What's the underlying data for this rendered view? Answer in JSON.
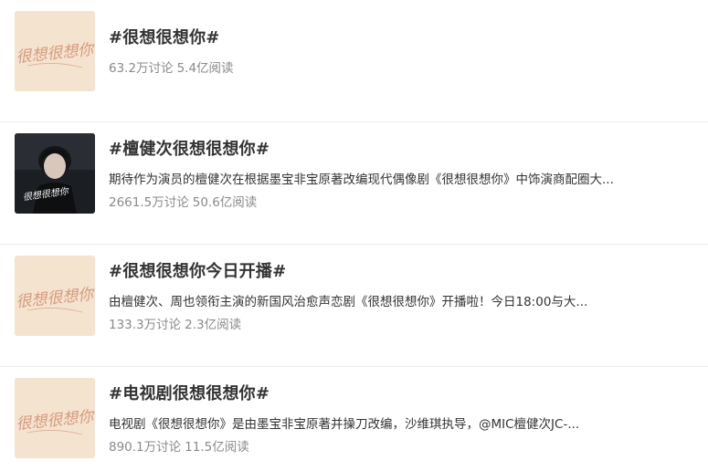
{
  "topics": [
    {
      "title": "#很想很想你#",
      "description": "",
      "discussions": "63.2万讨论",
      "reads": "5.4亿阅读",
      "thumbnail": {
        "kind": "poster",
        "background": "#f4e3cf",
        "script_color": "#d79a7e",
        "script_text": "很想很想你"
      }
    },
    {
      "title": "#檀健次很想很想你#",
      "description": "期待作为演员的檀健次在根据墨宝非宝原著改编现代偶像剧《很想很想你》中饰演商配圈大...",
      "discussions": "2661.5万讨论",
      "reads": "50.6亿阅读",
      "thumbnail": {
        "kind": "portrait",
        "background": "#1b1e22",
        "script_color": "#f2f2f2",
        "script_text": "很想很想你"
      }
    },
    {
      "title": "#很想很想你今日开播#",
      "description": "由檀健次、周也领衔主演的新国风治愈声恋剧《很想很想你》开播啦！今日18:00与大...",
      "discussions": "133.3万讨论",
      "reads": "2.3亿阅读",
      "thumbnail": {
        "kind": "poster",
        "background": "#f4e3cf",
        "script_color": "#d79a7e",
        "script_text": "很想很想你"
      }
    },
    {
      "title": "#电视剧很想很想你#",
      "description": "电视剧《很想很想你》是由墨宝非宝原著并操刀改编，沙维琪执导，@MIC檀健次JC-...",
      "discussions": "890.1万讨论",
      "reads": "11.5亿阅读",
      "thumbnail": {
        "kind": "poster",
        "background": "#f4e3cf",
        "script_color": "#d79a7e",
        "script_text": "很想很想你"
      }
    }
  ]
}
